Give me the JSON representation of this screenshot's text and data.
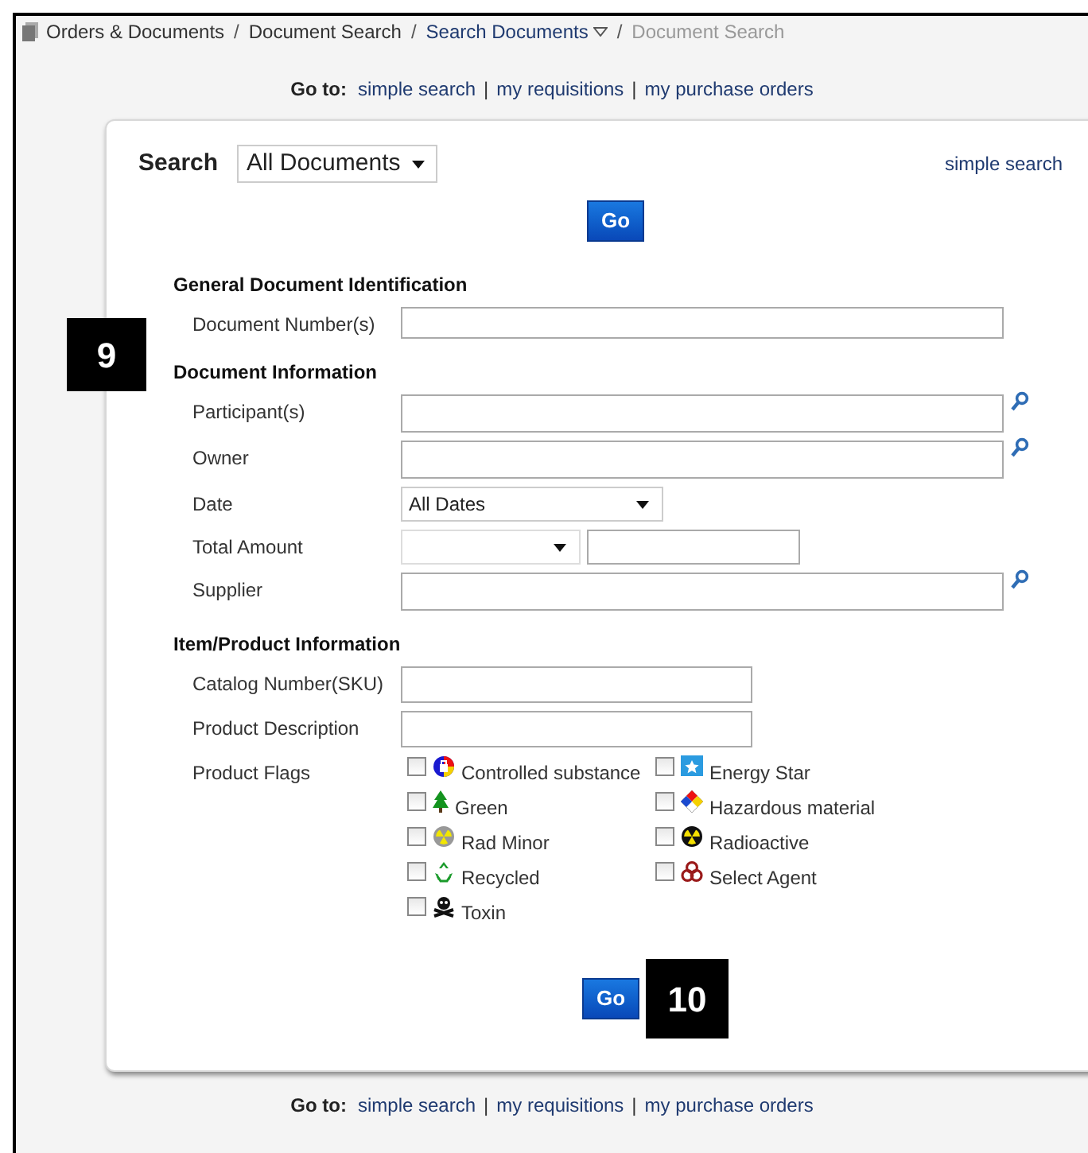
{
  "breadcrumb": [
    {
      "label": "Orders & Documents",
      "kind": "link"
    },
    {
      "separator": "/",
      "kind": "separator"
    },
    {
      "label": "Document Search",
      "kind": "link"
    },
    {
      "separator": "/",
      "kind": "separator"
    },
    {
      "label": "Search Documents",
      "kind": "dropdown"
    },
    {
      "separator": "/",
      "kind": "separator"
    },
    {
      "label": "Document Search",
      "kind": "current"
    }
  ],
  "goto_top": {
    "label": "Go to:",
    "links": [
      "simple search",
      "|",
      "my requisitions",
      "|",
      "my purchase orders"
    ]
  },
  "search": {
    "label": "Search",
    "scope": "All Documents",
    "simple_search": "simple search"
  },
  "go_button_top": "Go",
  "sections": [
    {
      "title": "General Document Identification",
      "fields": [
        {
          "label": "Document Number(s)",
          "kind": "text"
        }
      ]
    },
    {
      "title": "Document Information",
      "fields": [
        {
          "label": "Participant(s)",
          "kind": "lookup"
        },
        {
          "label": "Owner",
          "kind": "lookup"
        },
        {
          "label": "Date",
          "kind": "select",
          "value": "All Dates"
        },
        {
          "label": "Total Amount",
          "kind": "amount"
        },
        {
          "label": "Supplier",
          "kind": "lookup"
        }
      ]
    },
    {
      "title": "Item/Product Information",
      "fields": [
        {
          "label": "Catalog Number(SKU)",
          "kind": "short"
        },
        {
          "label": "Product Description",
          "kind": "short"
        },
        {
          "label": "Product Flags",
          "kind": "flags",
          "flags": [
            {
              "label": "Controlled substance",
              "checked": false
            },
            {
              "label": "Energy Star",
              "checked": false
            },
            {
              "label": "Green",
              "checked": false
            },
            {
              "label": "Hazardous material",
              "checked": false
            },
            {
              "label": "Rad Minor",
              "checked": false
            },
            {
              "label": "Radioactive",
              "checked": false
            },
            {
              "label": "Recycled",
              "checked": false
            },
            {
              "label": "Select Agent",
              "checked": false
            },
            {
              "label": "Toxin",
              "checked": false
            }
          ]
        }
      ]
    }
  ],
  "go_button_bottom": "Go",
  "callouts": [
    "9",
    "10"
  ],
  "goto_bottom": {
    "label": "Go to:",
    "links": [
      "simple search",
      "|",
      "my requisitions",
      "|",
      "my purchase orders"
    ]
  }
}
